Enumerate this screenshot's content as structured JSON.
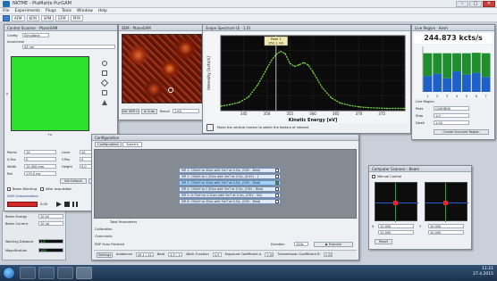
{
  "app": {
    "title": "NKTME - PtaMatte PurGAM",
    "window_min": "–",
    "window_max": "□",
    "window_close": "✕"
  },
  "menu": [
    "File",
    "Experiments",
    "Plugs",
    "Tools",
    "Window",
    "Help"
  ],
  "toolbar": [
    "AFM",
    "KFM",
    "SPM",
    "EFM",
    "PFM"
  ],
  "control": {
    "title": "Control Scanner - PtaneSAM",
    "config_label": "Config",
    "config_value": "Simultane",
    "scan_label": "Amulcheal",
    "scan_value": "45 nm",
    "x_axis": "+x",
    "y_axis": "y",
    "fields": [
      {
        "label": "Points",
        "value": "10",
        "label2": "Lines",
        "value2": "10"
      },
      {
        "label": "X-Pos",
        "value": "0",
        "label2": "Y-Pos",
        "value2": "0"
      },
      {
        "label": "Width",
        "value": "10.000 mm",
        "label2": "Height",
        "value2": "0.0"
      },
      {
        "label": "Rot",
        "value": "175.0 ms",
        "label2": "",
        "value2": ""
      }
    ],
    "btn_set_default": "Set Default",
    "btn_set_full": "Set Full Scale",
    "chk_beam": "Beam Blanking",
    "chk_after": "After Acquisition",
    "section_drift": "Drift Compensation",
    "progress": "0:00"
  },
  "leftstats": [
    {
      "label": "Beam Energy",
      "value": "10 kV"
    },
    {
      "label": "Beam Current",
      "value": "10 nA"
    },
    {
      "label": "Working Distance",
      "value": "1.5"
    },
    {
      "label": "Magnification",
      "value": "100"
    }
  ],
  "sem": {
    "title": "SEM - PtaneSAM",
    "tab_a": "Set SEM Image",
    "tab_b": "Al Auto",
    "label": "Recoil",
    "value": "1 KV"
  },
  "spectrum": {
    "title": "Scope Spectrum (E - 1.0)",
    "marker_label": "Peak 1",
    "marker_value": "352.1 nm",
    "hint": "Move the vertical marker to select the feature of interest",
    "chart_data": {
      "type": "line",
      "title": "",
      "xlabel": "Kinetic Energy [eV]",
      "ylabel": "Intensity [kcts/s]",
      "xlim": [
        340,
        380
      ],
      "ylim": [
        0,
        10
      ],
      "xticks": [
        345,
        350,
        355,
        360,
        365,
        370,
        375
      ],
      "x": [
        340,
        342,
        344,
        346,
        348,
        350,
        351,
        352,
        353,
        354,
        355,
        356,
        357,
        358,
        359,
        360,
        362,
        364,
        366,
        368,
        370,
        372,
        374,
        376,
        378,
        380
      ],
      "series": [
        {
          "values": [
            0.6,
            0.8,
            1.1,
            1.8,
            3.4,
            5.6,
            6.7,
            7.5,
            7.9,
            7.6,
            6.3,
            5.9,
            6.1,
            6.4,
            6.1,
            5.2,
            3.1,
            1.7,
            1.0,
            0.7,
            0.5,
            0.4,
            0.35,
            0.3,
            0.3,
            0.3
          ]
        }
      ],
      "marker_x": 352,
      "line_color": "#7fe84a",
      "background": "#0b0b0b",
      "grid": true
    }
  },
  "countrate": {
    "title": "Live Region - Kevh",
    "value": "244.873 kcts/s",
    "region_label": "Live Region",
    "rows": [
      {
        "label": "Peak",
        "value": "CASHBOX"
      },
      {
        "label": "Step",
        "value": "1.0"
      },
      {
        "label": "Dwell",
        "value": "1.00"
      }
    ],
    "btn_create": "Create Scanned Region",
    "bars": [
      {
        "blue": 0.35,
        "green": 0.5
      },
      {
        "blue": 0.4,
        "green": 0.45
      },
      {
        "blue": 0.3,
        "green": 0.55
      },
      {
        "blue": 0.45,
        "green": 0.4
      },
      {
        "blue": 0.38,
        "green": 0.47
      },
      {
        "blue": 0.42,
        "green": 0.44
      },
      {
        "blue": 0.33,
        "green": 0.52
      }
    ],
    "xticks": [
      "1",
      "2",
      "3",
      "4",
      "5",
      "6",
      "7"
    ]
  },
  "config": {
    "title": "Configuration",
    "tab_a": "Configuration",
    "tab_b": "Spectra",
    "spectra": [
      "ISR 1: 250nH to 4Gen with 5mT at 0.5/s, (OGV - Bled)",
      "ISR 2: 250nH to 1.2Gen with 5mT at 0.5/s, (0.0V) - 1",
      "ISR 3: 250nH to 4Gen with 5mT at 0.5/s, (OGV - Bled)",
      "ISR 4: 250nH to 2.5Gen with 5mT at 0.5/s, (OGV - Bled)",
      "ISR 5: 0.75nH to 4.2Gen with 5mT at 0.5/s, (OGV - 5kl)",
      "ISR 6: 250nH to 4Gen with 5mT at 0.5/s, (OGV - Bled)"
    ],
    "calibration": "Calibration",
    "comment": "Comments",
    "comment_box": "Total Parameters",
    "status": "EDP Scan Finished",
    "duration_label": "Duration",
    "duration": "120s",
    "execute": "▶ Execute"
  },
  "bottombar": [
    {
      "label": "Settings",
      "value": ""
    },
    {
      "label": "Ambience",
      "value": "45.1 / 12.00"
    },
    {
      "label": "Beat",
      "value": "4.5 / 1.2 s"
    },
    {
      "label": "Work Function",
      "value": "4.5"
    },
    {
      "label": "Exposure Coefficient A",
      "value": "0.00"
    },
    {
      "label": "Transmission Coefficient B",
      "value": "0.00"
    }
  ],
  "computer": {
    "title": "Computer Scanner - Beam",
    "manual": "Manual Control",
    "reset": "Reset",
    "xlabel": "X",
    "ylabel": "Y",
    "x1": "12.000",
    "y1": "10.000",
    "x2": "12.000",
    "y2": "10.000"
  },
  "clock": {
    "time": "11:21",
    "date": "27.4.2015"
  }
}
